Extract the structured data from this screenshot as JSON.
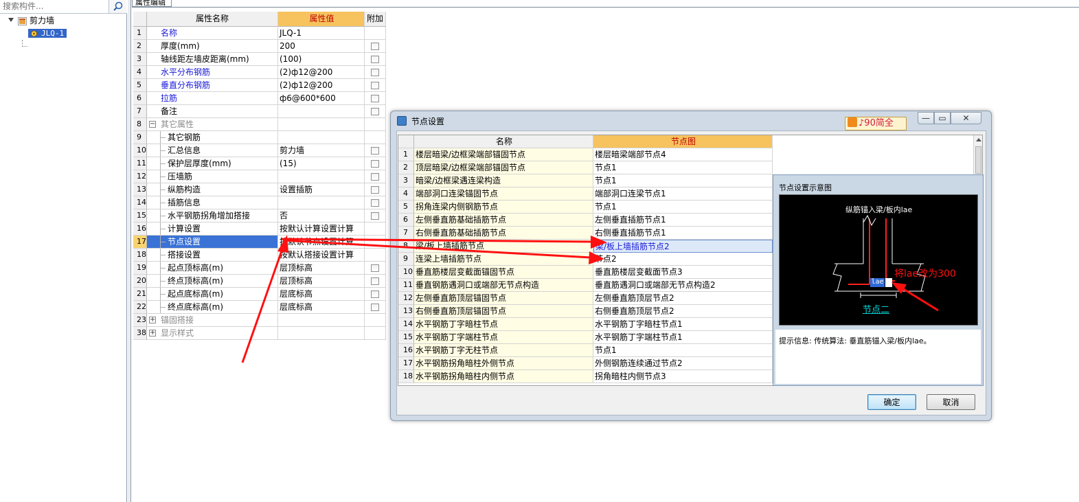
{
  "left_panel": {
    "search_placeholder": "搜索构件...",
    "tree": {
      "root_label": "剪力墙",
      "child_label": "JLQ-1"
    }
  },
  "property_editor": {
    "tab_label": "属性编辑",
    "headers": {
      "num": "",
      "name": "属性名称",
      "value": "属性值",
      "extra": "附加"
    },
    "rows": [
      {
        "num": "1",
        "name": "名称",
        "value": "JLQ-1",
        "style": "blue",
        "checkbox": false,
        "level": 0
      },
      {
        "num": "2",
        "name": "厚度(mm)",
        "value": "200",
        "style": "normal",
        "checkbox": true,
        "level": 0
      },
      {
        "num": "3",
        "name": "轴线距左墙皮距离(mm)",
        "value": "(100)",
        "style": "normal",
        "checkbox": true,
        "level": 0
      },
      {
        "num": "4",
        "name": "水平分布钢筋",
        "value": "(2)ф12@200",
        "style": "blue",
        "checkbox": true,
        "level": 0
      },
      {
        "num": "5",
        "name": "垂直分布钢筋",
        "value": "(2)ф12@200",
        "style": "blue",
        "checkbox": true,
        "level": 0
      },
      {
        "num": "6",
        "name": "拉筋",
        "value": "ф6@600*600",
        "style": "blue",
        "checkbox": true,
        "level": 0
      },
      {
        "num": "7",
        "name": "备注",
        "value": "",
        "style": "normal",
        "checkbox": true,
        "level": 0
      },
      {
        "num": "8",
        "name": "其它属性",
        "value": "",
        "style": "group",
        "checkbox": false,
        "level": -1,
        "expander": "−"
      },
      {
        "num": "9",
        "name": "其它钢筋",
        "value": "",
        "style": "normal",
        "checkbox": false,
        "level": 1
      },
      {
        "num": "10",
        "name": "汇总信息",
        "value": "剪力墙",
        "style": "normal",
        "checkbox": true,
        "level": 1
      },
      {
        "num": "11",
        "name": "保护层厚度(mm)",
        "value": "(15)",
        "style": "normal",
        "checkbox": true,
        "level": 1
      },
      {
        "num": "12",
        "name": "压墙筋",
        "value": "",
        "style": "normal",
        "checkbox": true,
        "level": 1
      },
      {
        "num": "13",
        "name": "纵筋构造",
        "value": "设置插筋",
        "style": "normal",
        "checkbox": true,
        "level": 1
      },
      {
        "num": "14",
        "name": "插筋信息",
        "value": "",
        "style": "normal",
        "checkbox": true,
        "level": 1
      },
      {
        "num": "15",
        "name": "水平钢筋拐角增加搭接",
        "value": "否",
        "style": "normal",
        "checkbox": true,
        "level": 1
      },
      {
        "num": "16",
        "name": "计算设置",
        "value": "按默认计算设置计算",
        "style": "normal",
        "checkbox": false,
        "level": 1
      },
      {
        "num": "17",
        "name": "节点设置",
        "value": "按默认节点设置计算",
        "style": "selected",
        "checkbox": false,
        "level": 1
      },
      {
        "num": "18",
        "name": "搭接设置",
        "value": "按默认搭接设置计算",
        "style": "normal",
        "checkbox": false,
        "level": 1
      },
      {
        "num": "19",
        "name": "起点顶标高(m)",
        "value": "层顶标高",
        "style": "normal",
        "checkbox": true,
        "level": 1
      },
      {
        "num": "20",
        "name": "终点顶标高(m)",
        "value": "层顶标高",
        "style": "normal",
        "checkbox": true,
        "level": 1
      },
      {
        "num": "21",
        "name": "起点底标高(m)",
        "value": "层底标高",
        "style": "normal",
        "checkbox": true,
        "level": 1
      },
      {
        "num": "22",
        "name": "终点底标高(m)",
        "value": "层底标高",
        "style": "normal",
        "checkbox": true,
        "level": 1
      },
      {
        "num": "23",
        "name": "锚固搭接",
        "value": "",
        "style": "group",
        "checkbox": false,
        "level": -1,
        "expander": "+"
      },
      {
        "num": "38",
        "name": "显示样式",
        "value": "",
        "style": "group",
        "checkbox": false,
        "level": -1,
        "expander": "+"
      }
    ]
  },
  "dialog": {
    "title": "节点设置",
    "ime_text": "♪90简全",
    "window_buttons": {
      "minimize": "—",
      "maximize": "▭",
      "close": "✕"
    },
    "table_headers": {
      "num": "",
      "name": "名称",
      "value": "节点图"
    },
    "rows": [
      {
        "num": "1",
        "name": "楼层暗梁/边框梁端部锚固节点",
        "value": "楼层暗梁端部节点4"
      },
      {
        "num": "2",
        "name": "顶层暗梁/边框梁端部锚固节点",
        "value": "节点1"
      },
      {
        "num": "3",
        "name": "暗梁/边框梁遇连梁构造",
        "value": "节点1"
      },
      {
        "num": "4",
        "name": "端部洞口连梁锚固节点",
        "value": "端部洞口连梁节点1"
      },
      {
        "num": "5",
        "name": "拐角连梁内侧钢筋节点",
        "value": "节点1"
      },
      {
        "num": "6",
        "name": "左侧垂直筋基础插筋节点",
        "value": "左侧垂直插筋节点1"
      },
      {
        "num": "7",
        "name": "右侧垂直筋基础插筋节点",
        "value": "右侧垂直插筋节点1"
      },
      {
        "num": "8",
        "name": "梁/板上墙插筋节点",
        "value": "梁/板上墙插筋节点2",
        "selected": true
      },
      {
        "num": "9",
        "name": "连梁上墙插筋节点",
        "value": "节点2"
      },
      {
        "num": "10",
        "name": "垂直筋楼层变截面锚固节点",
        "value": "垂直筋楼层变截面节点3"
      },
      {
        "num": "11",
        "name": "垂直钢筋遇洞口或端部无节点构造",
        "value": "垂直筋遇洞口或端部无节点构造2"
      },
      {
        "num": "12",
        "name": "左侧垂直筋顶层锚固节点",
        "value": "左侧垂直筋顶层节点2"
      },
      {
        "num": "13",
        "name": "右侧垂直筋顶层锚固节点",
        "value": "右侧垂直筋顶层节点2"
      },
      {
        "num": "14",
        "name": "水平钢筋丁字暗柱节点",
        "value": "水平钢筋丁字暗柱节点1"
      },
      {
        "num": "15",
        "name": "水平钢筋丁字端柱节点",
        "value": "水平钢筋丁字端柱节点1"
      },
      {
        "num": "16",
        "name": "水平钢筋丁字无柱节点",
        "value": "节点1"
      },
      {
        "num": "17",
        "name": "水平钢筋拐角暗柱外侧节点",
        "value": "外侧钢筋连续通过节点2"
      },
      {
        "num": "18",
        "name": "水平钢筋拐角暗柱内侧节点",
        "value": "拐角暗柱内侧节点3"
      }
    ],
    "preview": {
      "title": "节点设置示意图",
      "caption": "纵筋锚入梁/板内lae",
      "tag": "lae",
      "node_label": "节点二",
      "hint": "提示信息:  传统算法: 垂直筋锚入梁/板内lae。"
    },
    "buttons": {
      "ok": "确定",
      "cancel": "取消"
    }
  },
  "annotation": {
    "text": "将lae改为300",
    "color": "#ff1010"
  }
}
